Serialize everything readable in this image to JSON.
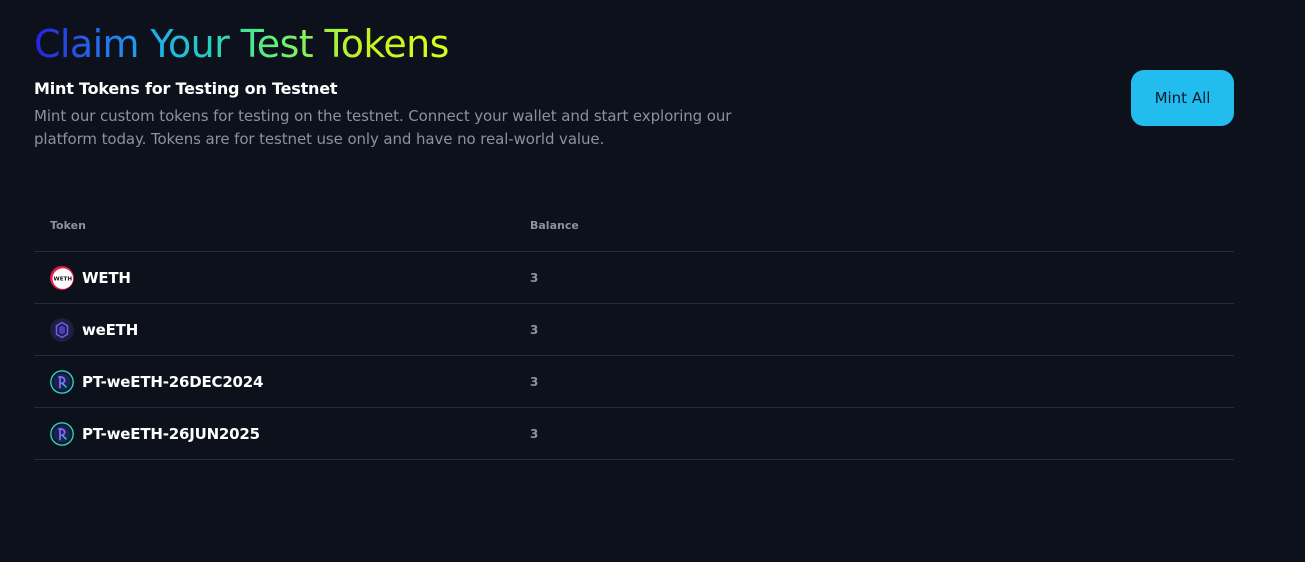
{
  "header": {
    "title": "Claim Your Test Tokens",
    "subtitle": "Mint Tokens for Testing on Testnet",
    "description": "Mint our custom tokens for testing on the testnet. Connect your wallet and start exploring our platform today. Tokens are for testnet use only and have no real-world value."
  },
  "actions": {
    "mint_all_label": "Mint All"
  },
  "table": {
    "columns": [
      "Token",
      "Balance"
    ],
    "rows": [
      {
        "token": "WETH",
        "balance": "3",
        "icon": "weth-icon"
      },
      {
        "token": "weETH",
        "balance": "3",
        "icon": "weeth-icon"
      },
      {
        "token": "PT-weETH-26DEC2024",
        "balance": "3",
        "icon": "pendle-pt-icon"
      },
      {
        "token": "PT-weETH-26JUN2025",
        "balance": "3",
        "icon": "pendle-pt-icon"
      }
    ]
  },
  "colors": {
    "background": "#0c111c",
    "accent_button": "#22bdee",
    "title_gradient": [
      "#2b20e0",
      "#1fa6f2",
      "#62f07a",
      "#d6ff1a"
    ]
  }
}
